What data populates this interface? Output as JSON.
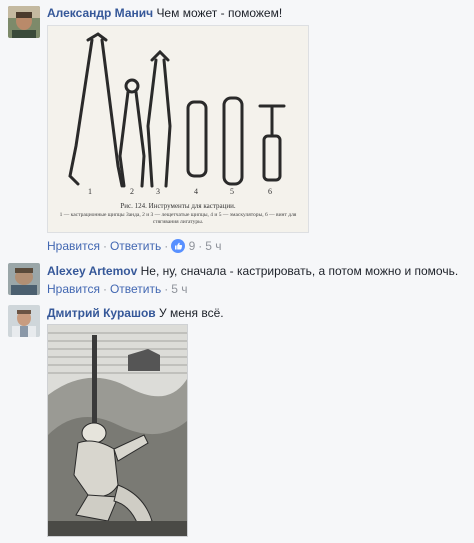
{
  "comments": [
    {
      "author": "Александр Манич",
      "text": "Чем может - поможем!",
      "actions": {
        "like": "Нравится",
        "reply": "Ответить",
        "reaction_icon": "like-icon",
        "reaction_count": "9",
        "time": "5 ч"
      },
      "image": {
        "caption": "Рис. 124. Инструменты для кастрации.",
        "legend": "1 — кастрационные щипцы Занда, 2 и 3 — лещетчатые щипцы, 4 и 5 — эмаскуляторы, 6 — винт для стягивания лигатуры.",
        "numbers": [
          "1",
          "2",
          "3",
          "4",
          "5",
          "6"
        ]
      }
    },
    {
      "author": "Alexey Artemov",
      "text": "Не, ну, сначала - кастрировать, а потом можно и помочь.",
      "actions": {
        "like": "Нравится",
        "reply": "Ответить",
        "time": "5 ч"
      }
    },
    {
      "author": "Дмитрий Курашов",
      "text": "У меня всё."
    }
  ],
  "colors": {
    "author": "#365899",
    "action_link": "#4267b2",
    "meta": "#90949c",
    "like_blue": "#5890ff",
    "background": "#f6f7f9"
  }
}
